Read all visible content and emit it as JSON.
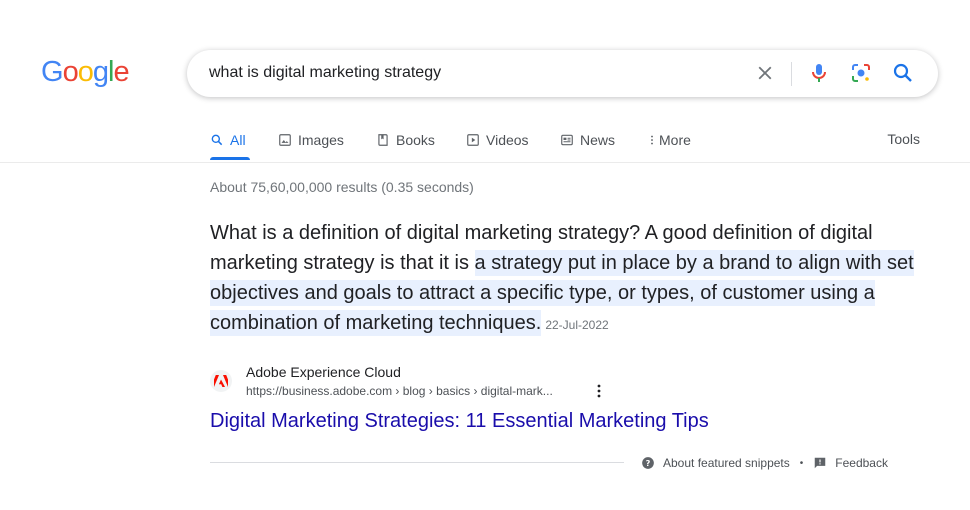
{
  "logo": {
    "letters": [
      "G",
      "o",
      "o",
      "g",
      "l",
      "e"
    ],
    "colors": [
      "#4285F4",
      "#EA4335",
      "#FBBC05",
      "#4285F4",
      "#34A853",
      "#EA4335"
    ]
  },
  "search": {
    "query": "what is digital marketing strategy",
    "icons": [
      "close-icon",
      "microphone-icon",
      "lens-icon",
      "search-icon"
    ]
  },
  "tabs": [
    {
      "label": "All",
      "icon": "search-icon",
      "active": true
    },
    {
      "label": "Images",
      "icon": "image-icon"
    },
    {
      "label": "Books",
      "icon": "book-icon"
    },
    {
      "label": "Videos",
      "icon": "play-icon"
    },
    {
      "label": "News",
      "icon": "news-icon"
    },
    {
      "label": "More",
      "icon": "more-vert-icon"
    }
  ],
  "tools_label": "Tools",
  "stats": "About 75,60,00,000 results (0.35 seconds)",
  "snippet": {
    "plain": "What is a definition of digital marketing strategy? A good definition of digital marketing strategy is that it is ",
    "highlight": "a strategy put in place by a brand to align with set objectives and goals to attract a specific type, or types, of customer using a combination of marketing techniques.",
    "date": "22-Jul-2022"
  },
  "source": {
    "name": "Adobe Experience Cloud",
    "url": "https://business.adobe.com › blog › basics › digital-mark...",
    "favicon": "adobe-icon"
  },
  "result_title": "Digital Marketing Strategies: 11 Essential Marketing Tips",
  "footer": {
    "about_label": "About featured snippets",
    "separator": "•",
    "feedback_label": "Feedback"
  },
  "colors": {
    "link": "#1a0dab",
    "accent": "#1a73e8",
    "highlight": "#e8f0fe",
    "adobe": "#fa0f00"
  }
}
